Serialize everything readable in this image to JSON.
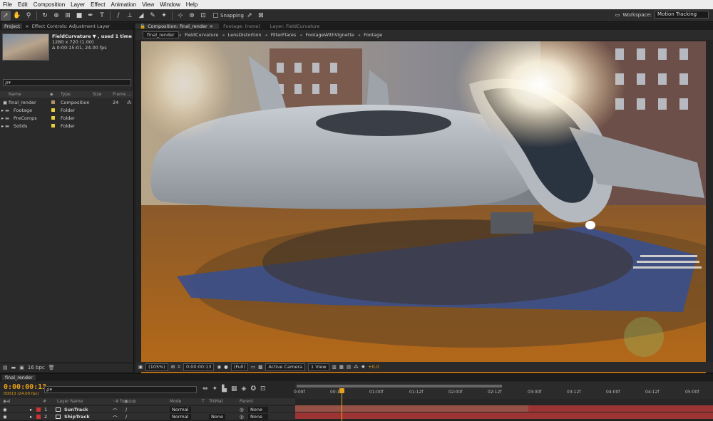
{
  "menu": [
    "File",
    "Edit",
    "Composition",
    "Layer",
    "Effect",
    "Animation",
    "View",
    "Window",
    "Help"
  ],
  "toolbar": {
    "snapping_label": "Snapping",
    "workspace_label": "Workspace:",
    "workspace_value": "Motion Tracking"
  },
  "project_panel": {
    "tab_project": "Project",
    "tab_effect_controls": "Effect Controls: Adjustment Layer",
    "thumb_name": "FieldCurvature ▼ , used 1 time",
    "thumb_res": "1280 x 720 (1.00)",
    "thumb_dur": "Δ 0:00:15:01, 24.00 fps",
    "search_placeholder": "ρ▾",
    "columns": {
      "name": "Name",
      "type": "Type",
      "size": "Size",
      "frame": "Frame ..."
    },
    "items": [
      {
        "name": "final_render",
        "type": "Composition",
        "size": "24",
        "color": "#b0946c"
      },
      {
        "name": "Footage",
        "type": "Folder",
        "size": "",
        "color": "#e6d13c"
      },
      {
        "name": "PreComps",
        "type": "Folder",
        "size": "",
        "color": "#e6d13c"
      },
      {
        "name": "Solids",
        "type": "Folder",
        "size": "",
        "color": "#e6d13c"
      }
    ],
    "bpc": "16 bpc"
  },
  "comp_panel": {
    "tabs": [
      {
        "label": "Composition: final_render",
        "active": true
      },
      {
        "label": "Footage: (none)",
        "active": false
      },
      {
        "label": "Layer: FieldCurvature",
        "active": false
      }
    ],
    "flowchart": [
      "final_render",
      "FieldCurvature",
      "LensDistortion",
      "FilterFlares",
      "FootageWithVignette",
      "Footage"
    ],
    "viewer_bar": {
      "zoom": "(105%)",
      "timecode": "0:00:00:13",
      "resolution": "(Full)",
      "camera": "Active Camera",
      "views": "1 View",
      "exposure": "+0.0"
    }
  },
  "timeline": {
    "tab": "final_render",
    "timecode": "0:00:00:13",
    "timecode_sub": "00013 (24.00 fps)",
    "search_placeholder": "ρ▾",
    "ruler_ticks": [
      "0:00f",
      "00:12f",
      "01:00f",
      "01:12f",
      "02:00f",
      "02:12f",
      "03:00f",
      "03:12f",
      "04:00f",
      "04:12f",
      "05:00f"
    ],
    "columns": {
      "layer_name": "Layer Name",
      "mode": "Mode",
      "t": "T",
      "trkmat": "TrkMat",
      "parent": "Parent"
    },
    "layers": [
      {
        "num": "1",
        "name": "SunTrack",
        "mode": "Normal",
        "trkmat": "",
        "parent": "None",
        "color": "#c33"
      },
      {
        "num": "2",
        "name": "ShipTrack",
        "mode": "Normal",
        "trkmat": "None",
        "parent": "None",
        "color": "#c33"
      }
    ],
    "playhead_percent": 11.1,
    "accent": "#e8a21c",
    "track_color": "#9c3434"
  }
}
